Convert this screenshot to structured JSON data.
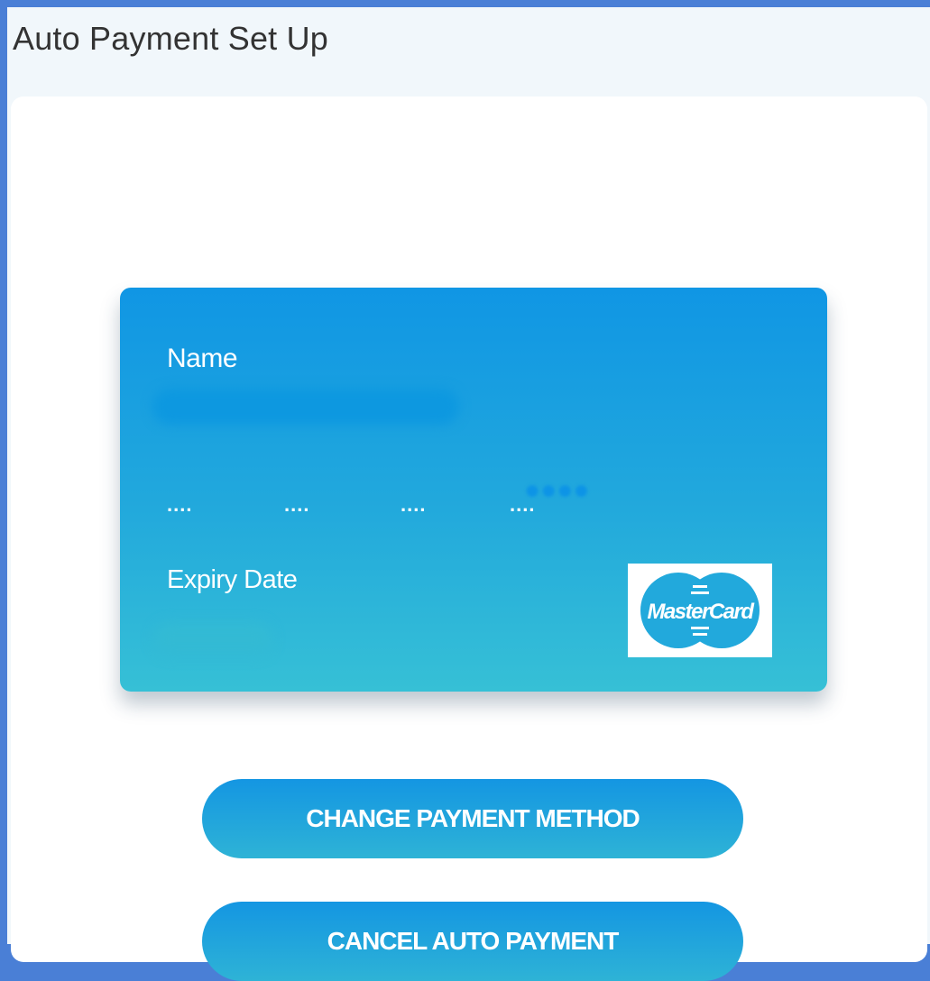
{
  "page": {
    "title": "Auto Payment Set Up"
  },
  "card": {
    "name_label": "Name",
    "number_groups": [
      "....",
      "....",
      "....",
      "...."
    ],
    "expiry_label": "Expiry Date",
    "brand": "MasterCard",
    "brand_icon": "mastercard-logo"
  },
  "actions": {
    "change_label": "CHANGE PAYMENT METHOD",
    "cancel_label": "CANCEL AUTO PAYMENT"
  },
  "colors": {
    "frame_border": "#4a7fd6",
    "page_background": "#f1f7fb",
    "card_gradient_top": "#1096e4",
    "card_gradient_bottom": "#36c0d6",
    "button_gradient_top": "#1496e2",
    "button_gradient_bottom": "#2eb3d6"
  }
}
